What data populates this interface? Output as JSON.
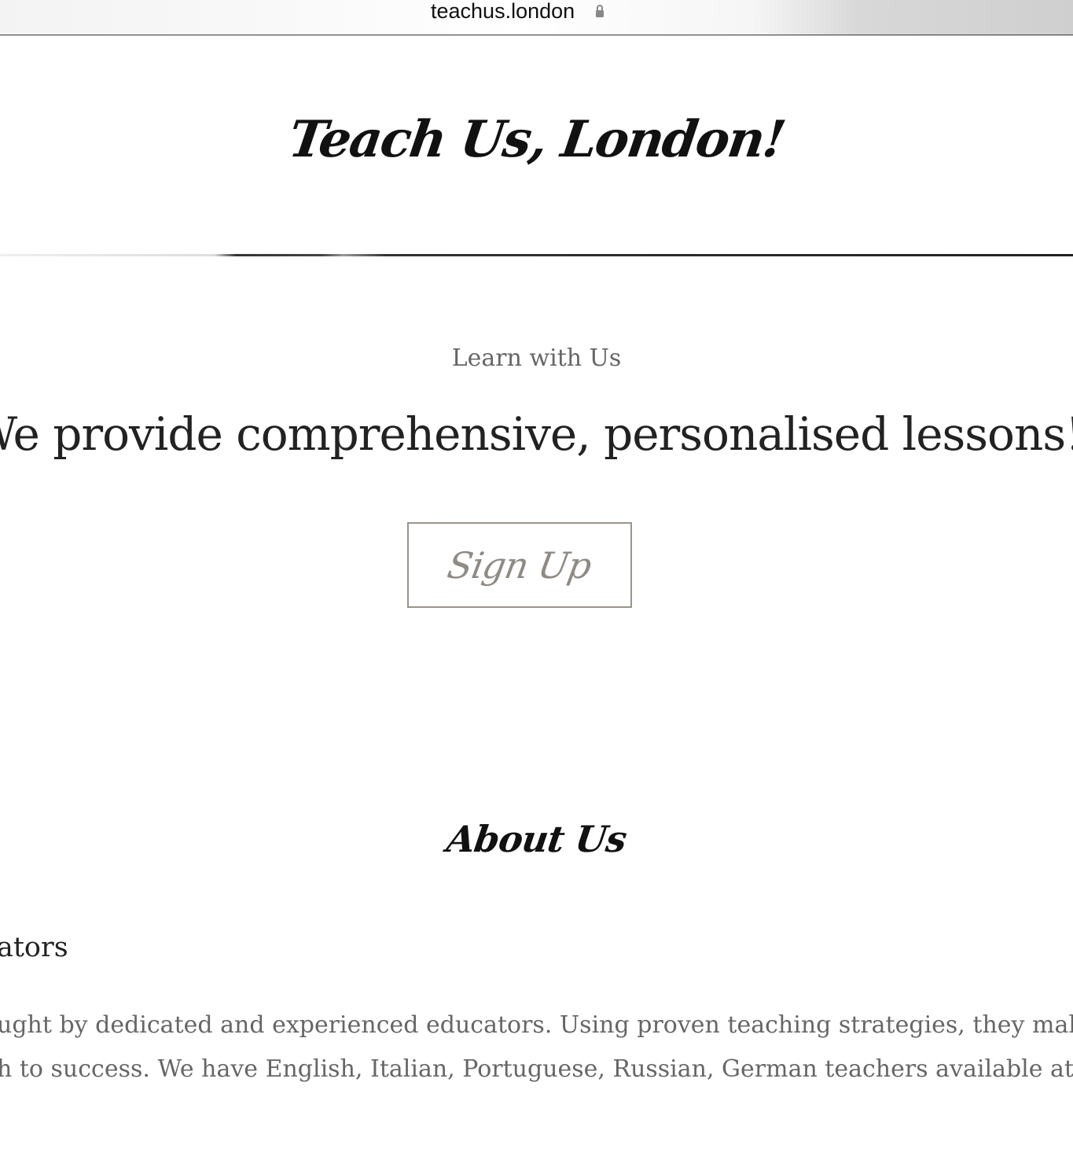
{
  "browser": {
    "url": "teachus.london"
  },
  "header": {
    "site_title": "Teach Us, London!"
  },
  "hero": {
    "eyebrow": "Learn with Us",
    "heading": "We provide comprehensive, personalised lessons!",
    "cta_label": "Sign Up"
  },
  "about": {
    "heading": "About Us",
    "subheading": "ators",
    "body_lines": [
      "ught by dedicated and experienced educators. Using proven teaching strategies, they make s",
      "h to success. We have English, Italian, Portuguese, Russian, German teachers available at the"
    ]
  },
  "colors": {
    "button_border": "#9a948c",
    "button_text": "#8f8a84",
    "text_dark": "#222222",
    "text_muted": "#666666"
  },
  "icons": {
    "lock": "lock-icon"
  }
}
